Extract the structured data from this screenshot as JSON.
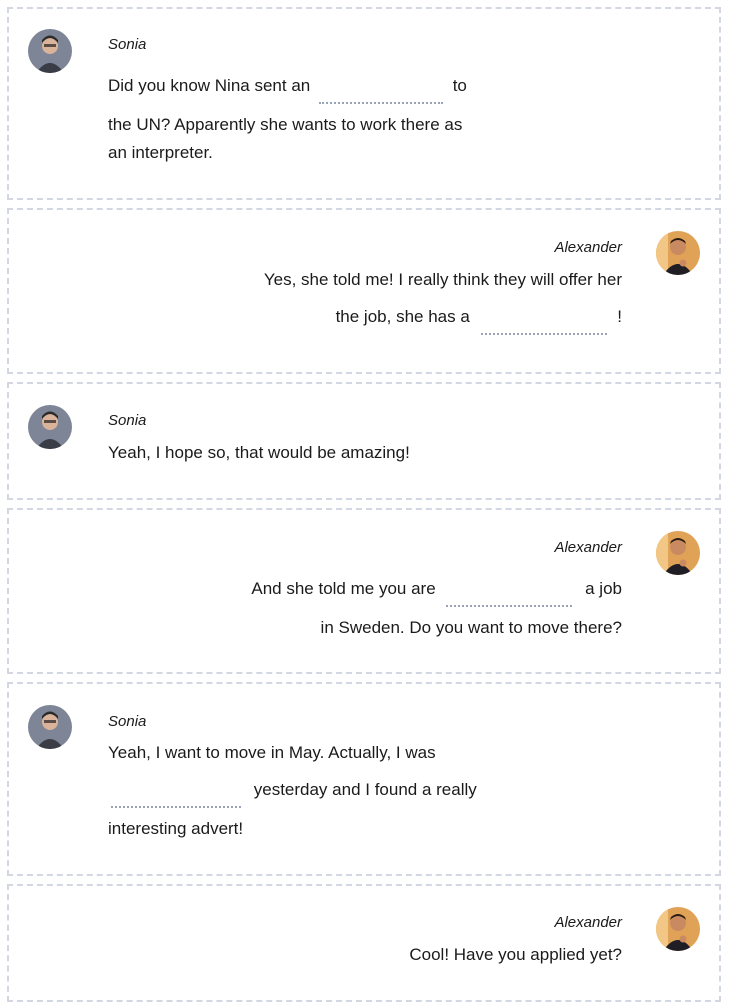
{
  "colors": {
    "border": "#d3d7e2",
    "blank_underline": "#9aa3b5",
    "text": "#1b1b1b"
  },
  "messages": [
    {
      "speaker": "Sonia",
      "align": "left",
      "lines": [
        {
          "before": "Did you know Nina sent an",
          "blank": true,
          "after": "to"
        },
        {
          "text": "the UN? Apparently she wants to work there as"
        },
        {
          "text": "an interpreter."
        }
      ]
    },
    {
      "speaker": "Alexander",
      "align": "right",
      "lines": [
        {
          "text": "Yes, she told me! I really think they will offer her"
        },
        {
          "before": "the job, she has a",
          "blank": true,
          "after": "!"
        }
      ]
    },
    {
      "speaker": "Sonia",
      "align": "left",
      "lines": [
        {
          "text": "Yeah, I hope so, that would be amazing!"
        }
      ]
    },
    {
      "speaker": "Alexander",
      "align": "right",
      "lines": [
        {
          "before": "And she told me you are",
          "blank": true,
          "after": "a job"
        },
        {
          "text": "in Sweden. Do you want to move there?"
        }
      ]
    },
    {
      "speaker": "Sonia",
      "align": "left",
      "lines": [
        {
          "text": "Yeah, I want to move in May. Actually, I was"
        },
        {
          "before": "",
          "blank": true,
          "after": "yesterday and I found a really"
        },
        {
          "text": "interesting advert!"
        }
      ]
    },
    {
      "speaker": "Alexander",
      "align": "right",
      "lines": [
        {
          "text": "Cool! Have you applied yet?"
        }
      ]
    }
  ]
}
